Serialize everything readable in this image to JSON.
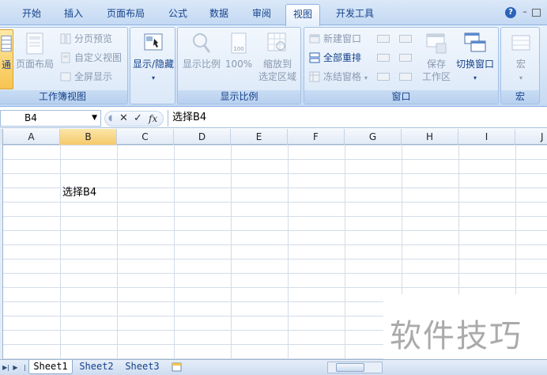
{
  "tabs": [
    {
      "label": "开始",
      "active": false
    },
    {
      "label": "插入",
      "active": false
    },
    {
      "label": "页面布局",
      "active": false
    },
    {
      "label": "公式",
      "active": false
    },
    {
      "label": "数据",
      "active": false
    },
    {
      "label": "审阅",
      "active": false
    },
    {
      "label": "视图",
      "active": true
    },
    {
      "label": "开发工具",
      "active": false
    }
  ],
  "ribbon": {
    "workbook_views": {
      "label": "工作簿视图",
      "normal": "通",
      "page_layout": "页面布局",
      "page_break_preview": "分页预览",
      "custom_views": "自定义视图",
      "full_screen": "全屏显示"
    },
    "show_hide": {
      "label": "显示/隐藏"
    },
    "zoom": {
      "label": "显示比例",
      "zoom_btn": "显示比例",
      "zoom_100": "100%",
      "zoom_selection_line1": "缩放到",
      "zoom_selection_line2": "选定区域"
    },
    "window": {
      "label": "窗口",
      "new_window": "新建窗口",
      "arrange_all": "全部重排",
      "freeze_panes": "冻结窗格",
      "save_workspace_line1": "保存",
      "save_workspace_line2": "工作区",
      "switch_windows": "切换窗口"
    },
    "macros": {
      "label": "宏",
      "macros_btn": "宏"
    }
  },
  "formula_bar": {
    "name_box": "B4",
    "fx": "fx",
    "content": "选择B4"
  },
  "columns": [
    "A",
    "B",
    "C",
    "D",
    "E",
    "F",
    "G",
    "H",
    "I",
    "J"
  ],
  "cells": {
    "B4": "选择B4"
  },
  "sheets": [
    {
      "name": "Sheet1",
      "active": true
    },
    {
      "name": "Sheet2",
      "active": false
    },
    {
      "name": "Sheet3",
      "active": false
    }
  ],
  "watermark": "软件技巧"
}
